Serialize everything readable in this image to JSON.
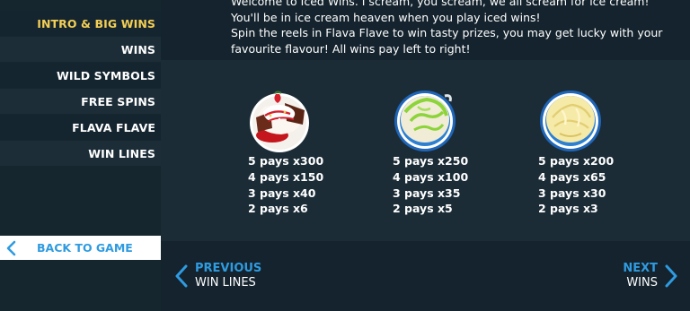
{
  "sidebar": {
    "items": [
      {
        "label": "INTRO & BIG WINS",
        "active": true
      },
      {
        "label": "WINS",
        "active": false
      },
      {
        "label": "WILD SYMBOLS",
        "active": false
      },
      {
        "label": "FREE SPINS",
        "active": false
      },
      {
        "label": "FLAVA FLAVE",
        "active": false
      },
      {
        "label": "WIN LINES",
        "active": false
      }
    ],
    "back_label": "BACK TO GAME"
  },
  "intro": {
    "lines": [
      "Welcome to Iced Wins. I scream, you scream, we all scream for ice cream!",
      "You'll be in ice cream heaven when you play iced wins!",
      "Spin the reels in Flava Flave to win tasty prizes, you may get lucky with your",
      "favourite flavour! All wins pay left to right!"
    ]
  },
  "symbols": [
    {
      "icon": "strawberry-brownie-sundae-icon",
      "pays": [
        "5 pays x300",
        "4 pays x150",
        "3 pays x40",
        "2 pays x6"
      ]
    },
    {
      "icon": "lime-swirl-scoop-icon",
      "pays": [
        "5 pays x250",
        "4 pays x100",
        "3 pays x35",
        "2 pays x5"
      ]
    },
    {
      "icon": "vanilla-scoop-icon",
      "pays": [
        "5 pays x200",
        "4 pays x65",
        "3 pays x30",
        "2 pays x3"
      ]
    }
  ],
  "nav": {
    "previous": {
      "title": "PREVIOUS",
      "sub": "WIN LINES"
    },
    "next": {
      "title": "NEXT",
      "sub": "WINS"
    }
  },
  "colors": {
    "accent_blue": "#2f9be0",
    "active_yellow": "#f4cf54",
    "background": "#192a35"
  }
}
